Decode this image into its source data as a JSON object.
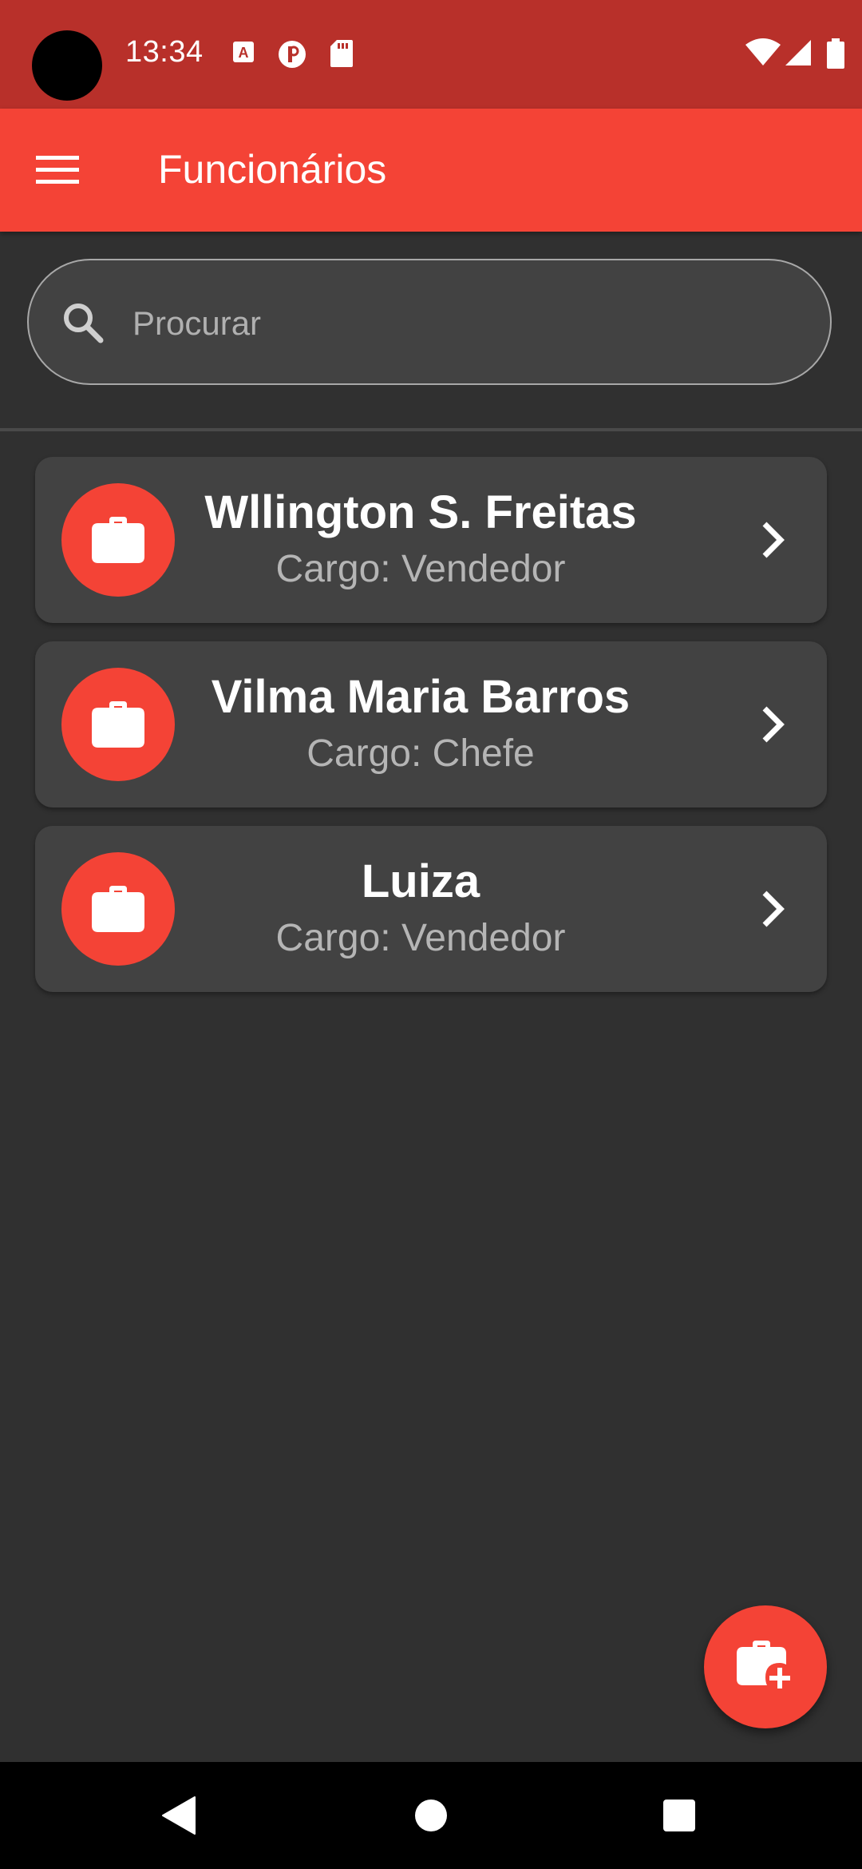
{
  "status_bar": {
    "time": "13:34",
    "left_icons": [
      "text-a-icon",
      "pinterest-icon",
      "sd-card-icon"
    ],
    "right_icons": [
      "wifi-icon",
      "signal-icon",
      "battery-icon"
    ]
  },
  "app_bar": {
    "title": "Funcionários",
    "menu_icon": "hamburger-menu-icon"
  },
  "search": {
    "placeholder": "Procurar",
    "value": "",
    "icon": "search-icon"
  },
  "employees": [
    {
      "name": "Wllington S. Freitas",
      "role": "Cargo: Vendedor"
    },
    {
      "name": "Vilma Maria Barros",
      "role": "Cargo: Chefe"
    },
    {
      "name": "Luiza",
      "role": "Cargo: Vendedor"
    }
  ],
  "fab": {
    "icon": "add-employee-briefcase-icon"
  },
  "nav_bar": {
    "buttons": [
      "back-triangle-icon",
      "home-circle-icon",
      "recents-square-icon"
    ]
  },
  "colors": {
    "status_bar": "#b8302a",
    "accent": "#f44336",
    "background": "#303030",
    "card": "#424242",
    "secondary_text": "#b5b5b5"
  }
}
